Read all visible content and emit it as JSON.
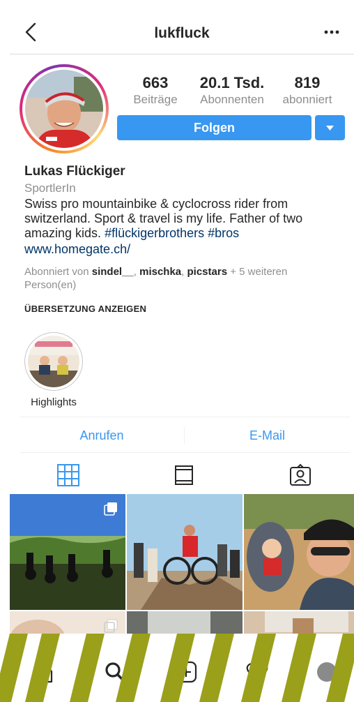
{
  "header": {
    "username": "lukfluck"
  },
  "stats": [
    {
      "value": "663",
      "label": "Beiträge"
    },
    {
      "value": "20.1 Tsd.",
      "label": "Abonnenten"
    },
    {
      "value": "819",
      "label": "abonniert"
    }
  ],
  "actions": {
    "follow_label": "Folgen"
  },
  "bio": {
    "name": "Lukas Flückiger",
    "category": "SportlerIn",
    "text": "Swiss pro mountainbike & cyclocross rider from switzerland. Sport & travel is my life. Father of two amazing kids. ",
    "tag1": "#flückigerbrothers",
    "tag2": "#bros",
    "link": "www.homegate.ch/"
  },
  "followed_by": {
    "prefix": "Abonniert von ",
    "user1": "sindel__",
    "user2": "mischka",
    "user3": "picstars",
    "suffix": " + 5 weiteren Person(en)"
  },
  "translate_label": "ÜBERSETZUNG ANZEIGEN",
  "highlights": [
    {
      "label": "Highlights"
    }
  ],
  "contact": {
    "call_label": "Anrufen",
    "email_label": "E-Mail"
  },
  "colors": {
    "accent": "#3897f0",
    "link": "#003569",
    "muted": "#8e8e8e",
    "stripe": "#9aa01a"
  },
  "icons": {
    "back": "chevron-left-icon",
    "more": "more-horizontal-icon",
    "dropdown": "triangle-down-icon",
    "tabs": [
      "grid-icon",
      "feed-icon",
      "tagged-icon"
    ],
    "nav": [
      "home-icon",
      "search-icon",
      "add-icon",
      "heart-icon",
      "profile-icon"
    ]
  }
}
